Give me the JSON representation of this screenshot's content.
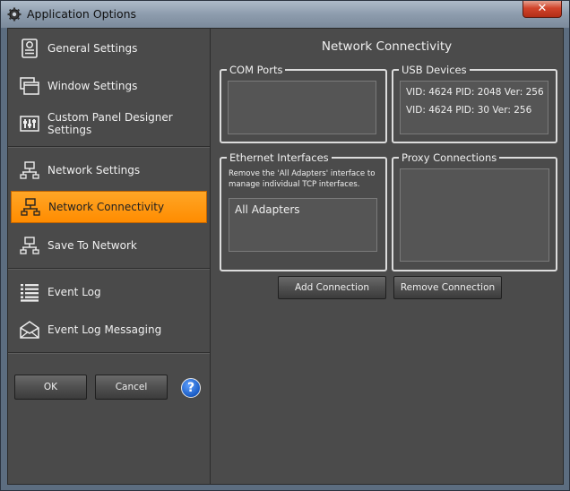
{
  "window": {
    "title": "Application Options",
    "close_label": "✕"
  },
  "sidebar": {
    "items": [
      {
        "label": "General Settings",
        "icon": "general-settings-icon"
      },
      {
        "label": "Window Settings",
        "icon": "window-settings-icon"
      },
      {
        "label": "Custom Panel Designer Settings",
        "icon": "panel-designer-icon"
      },
      {
        "label": "Network Settings",
        "icon": "network-icon"
      },
      {
        "label": "Network Connectivity",
        "icon": "network-icon",
        "active": true
      },
      {
        "label": "Save To Network",
        "icon": "network-save-icon"
      },
      {
        "label": "Event Log",
        "icon": "event-log-icon"
      },
      {
        "label": "Event Log Messaging",
        "icon": "envelope-icon"
      }
    ],
    "ok_label": "OK",
    "cancel_label": "Cancel",
    "help_label": "?"
  },
  "main": {
    "heading": "Network Connectivity",
    "com_ports": {
      "legend": "COM Ports",
      "items": []
    },
    "usb_devices": {
      "legend": "USB Devices",
      "items": [
        "VID: 4624 PID: 2048 Ver: 256",
        "VID: 4624 PID: 30 Ver: 256"
      ]
    },
    "ethernet": {
      "legend": "Ethernet Interfaces",
      "description": "Remove the 'All Adapters' interface to manage individual TCP interfaces.",
      "items": [
        "All Adapters"
      ]
    },
    "proxy": {
      "legend": "Proxy Connections",
      "items": []
    },
    "add_connection_label": "Add Connection",
    "remove_connection_label": "Remove Connection"
  },
  "colors": {
    "accent": "#ff9c0f",
    "panel": "#4b4b4b",
    "text": "#f0f0f0"
  }
}
